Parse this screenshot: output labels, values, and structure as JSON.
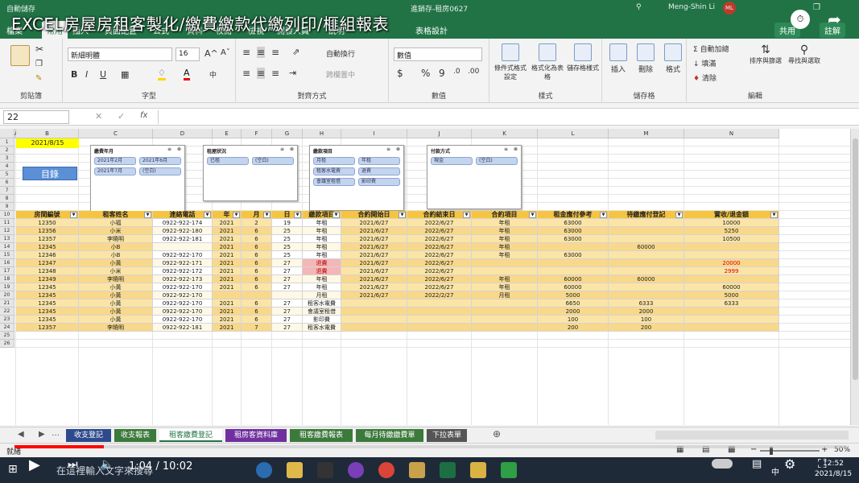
{
  "video": {
    "title": "EXCEL房屋房租客製化/繳費繳款代繳列印/榧組報表",
    "time_current": "1:04",
    "time_separator": "/",
    "time_total": "10:02",
    "progress": 0.107
  },
  "window": {
    "autosave": "自動儲存",
    "filename": "進銷存-租房0627",
    "user": "Meng-Shin Li",
    "avatar": "ML",
    "share": "共用",
    "comments": "註解"
  },
  "menu": {
    "items": [
      "檔案",
      "常用",
      "插入",
      "頁面配置",
      "公式",
      "資料",
      "校閱",
      "檢視",
      "開發人員",
      "說明",
      "表格設計"
    ],
    "active_index": 1
  },
  "ribbon": {
    "clipboard": {
      "label": "剪貼簿",
      "paste": "貼上"
    },
    "font": {
      "label": "字型",
      "name": "新細明體",
      "size": "16",
      "bold": "B",
      "italic": "I",
      "underline": "U",
      "grow": "A^",
      "shrink": "Aˇ"
    },
    "alignment": {
      "label": "對齊方式",
      "wrap": "自動換行",
      "merge": "跨欄置中"
    },
    "number": {
      "label": "數值",
      "format": "數值",
      "currency": "$",
      "percent": "%",
      "comma": "9"
    },
    "styles": {
      "label": "樣式",
      "conditional": "條件式格式設定",
      "as_table": "格式化為表格",
      "cell_styles": "儲存格樣式"
    },
    "cells": {
      "label": "儲存格",
      "insert": "插入",
      "delete": "刪除",
      "format": "格式"
    },
    "editing": {
      "label": "編輯",
      "autosum": "自動加總",
      "fill": "填滿",
      "clear": "清除",
      "sort": "排序與篩選",
      "find": "尋找與選取"
    }
  },
  "formula_bar": {
    "namebox": "22",
    "cancel": "✕",
    "enter": "✓",
    "fx": "fx"
  },
  "sheet": {
    "columns": [
      "A",
      "B",
      "C",
      "D",
      "E",
      "F",
      "G",
      "H",
      "I",
      "J",
      "K",
      "L",
      "M",
      "N"
    ],
    "rows": [
      "1",
      "2",
      "3",
      "4",
      "5",
      "6",
      "7",
      "8",
      "9",
      "10",
      "11",
      "12",
      "13",
      "14",
      "15",
      "16",
      "17",
      "18",
      "19",
      "20",
      "21",
      "22",
      "23",
      "24",
      "25",
      "26"
    ],
    "date_cell": "2021/8/15",
    "toc_button": "目錄",
    "slicers": [
      {
        "title": "繳費年月",
        "items": [
          "2021年2月",
          "2021年6月",
          "2021年7月",
          "(空白)"
        ]
      },
      {
        "title": "租屋狀況",
        "items": [
          "已租",
          "(空白)"
        ]
      },
      {
        "title": "繳款項目",
        "items": [
          "月租",
          "年租",
          "租客水電費",
          "退費",
          "會議室租借",
          "影印費"
        ]
      },
      {
        "title": "付款方式",
        "items": [
          "現金",
          "(空白)"
        ]
      }
    ],
    "table_headers": [
      "房間編號",
      "租客姓名",
      "連絡電話",
      "年",
      "月",
      "日",
      "繳款項目",
      "合約開始日",
      "合約結束日",
      "合約項目",
      "租金應付參考",
      "待繳應付登記",
      "實收/退金額"
    ],
    "table_rows": [
      [
        "12350",
        "小福",
        "0922-922-174",
        "2021",
        "2",
        "19",
        "年租",
        "2021/6/27",
        "2022/6/27",
        "年租",
        "63000",
        "",
        "10000"
      ],
      [
        "12356",
        "小米",
        "0922-922-180",
        "2021",
        "6",
        "25",
        "年租",
        "2021/6/27",
        "2022/6/27",
        "年租",
        "63000",
        "",
        "5250"
      ],
      [
        "12357",
        "李曉明",
        "0922-922-181",
        "2021",
        "6",
        "25",
        "年租",
        "2021/6/27",
        "2022/6/27",
        "年租",
        "63000",
        "",
        "10500"
      ],
      [
        "12345",
        "小B",
        "",
        "2021",
        "6",
        "25",
        "年租",
        "2021/6/27",
        "2022/6/27",
        "年租",
        "",
        "60000",
        ""
      ],
      [
        "12346",
        "小B",
        "0922-922-170",
        "2021",
        "6",
        "25",
        "年租",
        "2021/6/27",
        "2022/6/27",
        "年租",
        "63000",
        "",
        ""
      ],
      [
        "12347",
        "小黃",
        "0922-922-171",
        "2021",
        "6",
        "27",
        "退費",
        "2021/6/27",
        "2022/6/27",
        "",
        "",
        "",
        "20000"
      ],
      [
        "12348",
        "小米",
        "0922-922-172",
        "2021",
        "6",
        "27",
        "退費",
        "2021/6/27",
        "2022/6/27",
        "",
        "",
        "",
        "2999"
      ],
      [
        "12349",
        "李曉明",
        "0922-922-173",
        "2021",
        "6",
        "27",
        "年租",
        "2021/6/27",
        "2022/6/27",
        "年租",
        "60000",
        "60000",
        ""
      ],
      [
        "12345",
        "小黃",
        "0922-922-170",
        "2021",
        "6",
        "27",
        "年租",
        "2021/6/27",
        "2022/6/27",
        "年租",
        "60000",
        "",
        "60000"
      ],
      [
        "12345",
        "小黃",
        "0922-922-170",
        "",
        "",
        "",
        "月租",
        "2021/6/27",
        "2022/2/27",
        "月租",
        "5000",
        "",
        "5000"
      ],
      [
        "12345",
        "小黃",
        "0922-922-170",
        "2021",
        "6",
        "27",
        "租客水電費",
        "",
        "",
        "",
        "6650",
        "6333",
        "6333"
      ],
      [
        "12345",
        "小黃",
        "0922-922-170",
        "2021",
        "6",
        "27",
        "會議室租借",
        "",
        "",
        "",
        "2000",
        "2000",
        ""
      ],
      [
        "12345",
        "小黃",
        "0922-922-170",
        "2021",
        "6",
        "27",
        "影印費",
        "",
        "",
        "",
        "100",
        "100",
        ""
      ],
      [
        "12357",
        "李曉明",
        "0922-922-181",
        "2021",
        "7",
        "27",
        "租客水電費",
        "",
        "",
        "",
        "200",
        "200",
        ""
      ]
    ],
    "refund_rows": [
      5,
      6
    ]
  },
  "sheet_tabs": [
    {
      "label": "收支登記",
      "color": "#2e4a8c"
    },
    {
      "label": "收支報表",
      "color": "#3b7a3b"
    },
    {
      "label": "租客繳費登記",
      "color": "#ffffff"
    },
    {
      "label": "租房客資料庫",
      "color": "#7030a0"
    },
    {
      "label": "租客繳費報表",
      "color": "#3b7a3b"
    },
    {
      "label": "每月待繳繳費單",
      "color": "#3b7a3b"
    },
    {
      "label": "下拉表單",
      "color": "#555555"
    }
  ],
  "status": {
    "ready": "就緒",
    "zoom": "50%"
  },
  "taskbar": {
    "search_placeholder": "在這裡輸入文字來搜尋",
    "clock_time": "12:52",
    "clock_date": "2021/8/15",
    "ime": "中"
  }
}
